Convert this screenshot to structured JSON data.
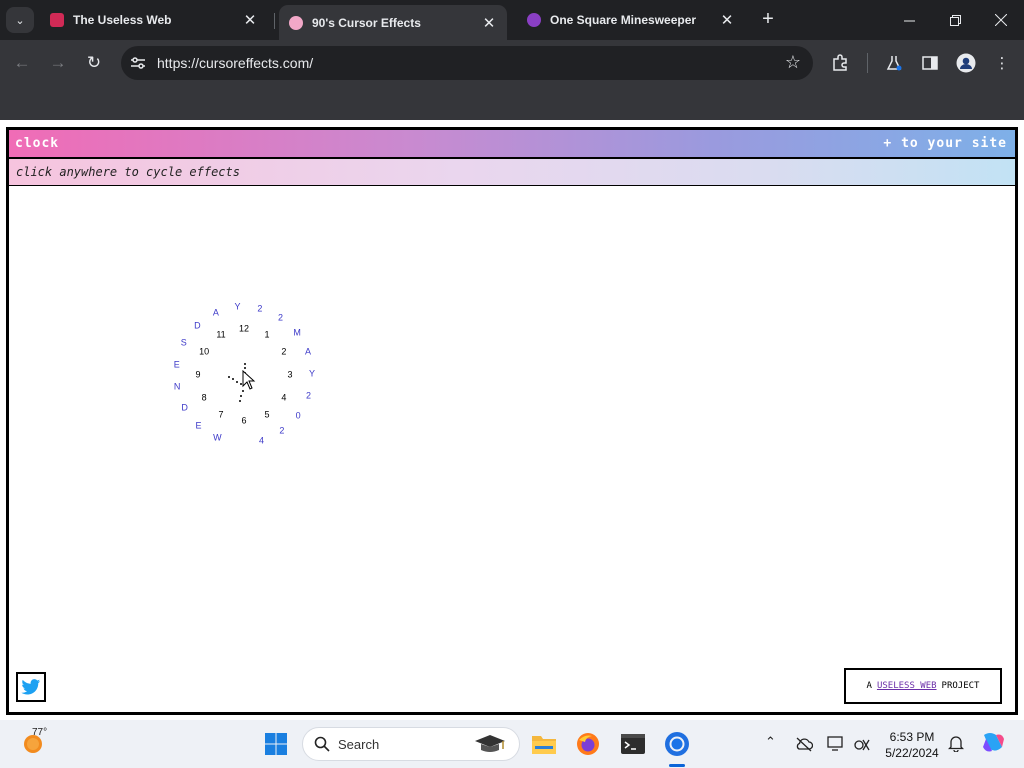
{
  "browser": {
    "tabs": [
      {
        "title": "The Useless Web",
        "favicon_color": "#d12a56",
        "active": false
      },
      {
        "title": "90's Cursor Effects",
        "favicon_color": "#f2a8c8",
        "active": true
      },
      {
        "title": "One Square Minesweeper",
        "favicon_color": "#8a3fc4",
        "active": false
      }
    ],
    "url": "https://cursoreffects.com/"
  },
  "page": {
    "header_left": "clock",
    "header_right": "+ to your site",
    "subheader": "click anywhere to cycle effects",
    "clock_numbers": [
      "12",
      "1",
      "2",
      "3",
      "4",
      "5",
      "6",
      "7",
      "8",
      "9",
      "10",
      "11"
    ],
    "date_chars": [
      "W",
      "E",
      "D",
      "N",
      "E",
      "S",
      "D",
      "A",
      "Y",
      "2",
      "2",
      "M",
      "A",
      "Y",
      "2",
      "0",
      "2",
      "4"
    ],
    "footer_prefix": "A",
    "footer_link": "USELESS WEB",
    "footer_suffix": "PROJECT"
  },
  "taskbar": {
    "temperature": "77°",
    "search_label": "Search",
    "time": "6:53 PM",
    "date": "5/22/2024"
  },
  "colors": {
    "chrome_dark": "#202124",
    "chrome_toolbar": "#35363a",
    "date_text": "#3b38c8",
    "header_pink": "#f06cb6",
    "header_blue": "#7eb0e8"
  }
}
